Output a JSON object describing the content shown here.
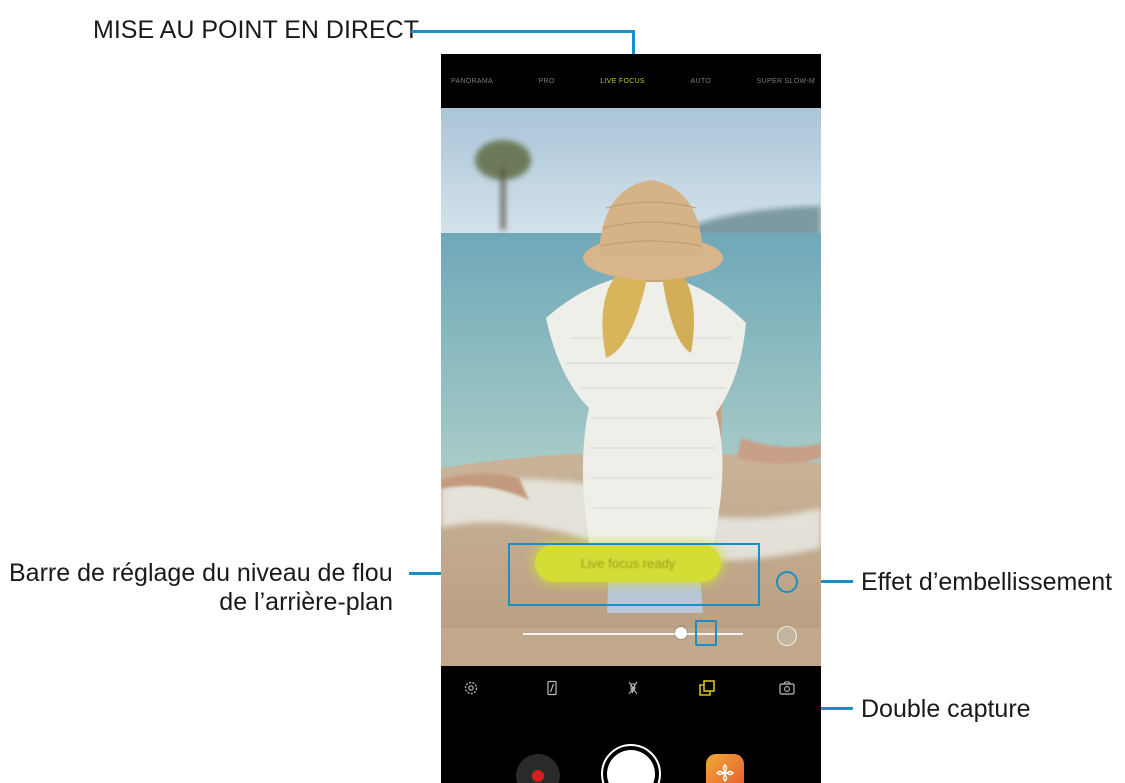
{
  "callouts": {
    "live_focus": "MISE AU POINT EN DIRECT",
    "blur_bar_line1": "Barre de réglage du niveau de flou",
    "blur_bar_line2": "de l’arrière-plan",
    "beauty_effect": "Effet d’embellissement",
    "dual_capture": "Double capture"
  },
  "camera": {
    "modes": [
      "PANORAMA",
      "PRO",
      "LIVE FOCUS",
      "AUTO",
      "SUPER SLOW-M"
    ],
    "active_mode": "LIVE FOCUS",
    "status_pill": "Live focus ready",
    "blur_level": 0.72,
    "toolbar_icons": [
      "settings-icon",
      "flash-icon",
      "flash-off-icon",
      "dual-capture-icon",
      "switch-camera-icon"
    ],
    "bottom_controls": [
      "record-icon",
      "shutter",
      "bixby-vision-icon"
    ]
  },
  "colors": {
    "accent_line": "#1a8fc4",
    "active_mode": "#b8cb3a",
    "pill": "#d4dd36",
    "dual_capture_icon": "#d8c020",
    "record_dot": "#d42020"
  }
}
